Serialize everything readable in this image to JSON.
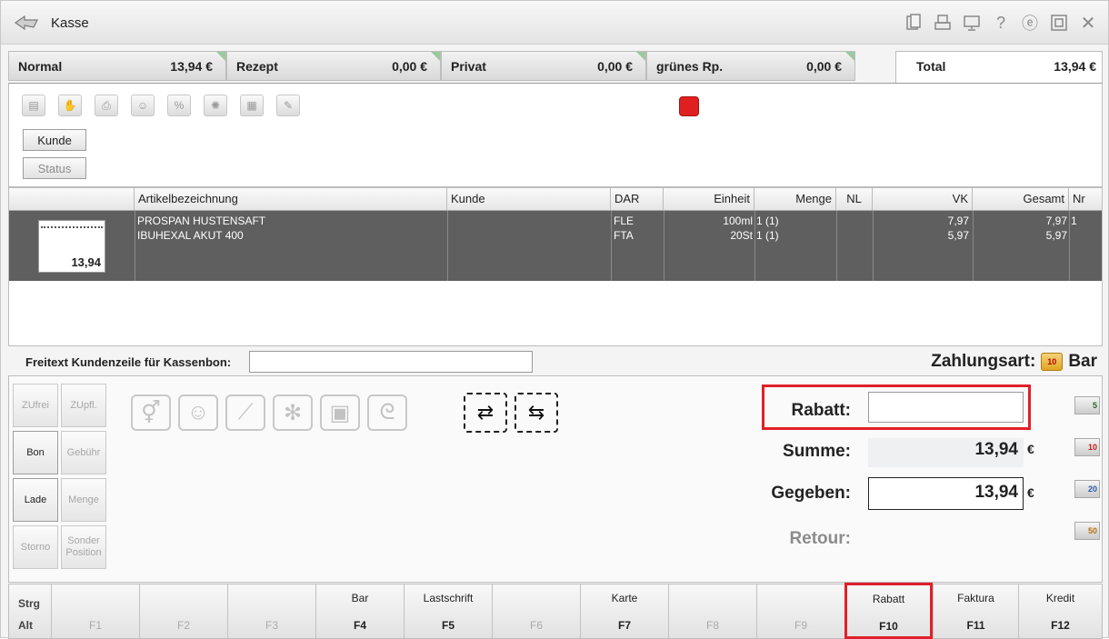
{
  "window": {
    "title": "Kasse"
  },
  "title_icons": [
    "clipboard-icon",
    "printer-icon",
    "monitor-icon",
    "help-icon",
    "e-icon",
    "restore-icon",
    "close-icon"
  ],
  "tabs": [
    {
      "label": "Normal",
      "value": "13,94 €"
    },
    {
      "label": "Rezept",
      "value": "0,00 €"
    },
    {
      "label": "Privat",
      "value": "0,00 €"
    },
    {
      "label": "grünes Rp.",
      "value": "0,00 €"
    }
  ],
  "total_tab": {
    "label": "Total",
    "value": "13,94 €"
  },
  "toolbar": {
    "kunde_label": "Kunde",
    "status_label": "Status"
  },
  "table": {
    "headers": [
      "Artikelbezeichnung",
      "Kunde",
      "DAR",
      "Einheit",
      "Menge",
      "NL",
      "VK",
      "Gesamt",
      "Nr"
    ],
    "receipt_total": "13,94",
    "rows": [
      {
        "name": "PROSPAN HUSTENSAFT",
        "kunde": "",
        "dar": "FLE",
        "einheit": "100ml",
        "menge": "1 (1)",
        "nl": "",
        "vk": "7,97",
        "gesamt": "7,97",
        "nr": "1"
      },
      {
        "name": "IBUHEXAL AKUT 400",
        "kunde": "",
        "dar": "FTA",
        "einheit": "20St",
        "menge": "1 (1)",
        "nl": "",
        "vk": "5,97",
        "gesamt": "5,97",
        "nr": ""
      }
    ]
  },
  "freitext": {
    "label": "Freitext Kundenzeile für Kassenbon:",
    "value": ""
  },
  "zahlungsart": {
    "label": "Zahlungsart:",
    "value": "Bar"
  },
  "left_buttons": {
    "zufrei": "ZUfrei",
    "zupfl": "ZUpfl.",
    "bon": "Bon",
    "gebuehr": "Gebühr",
    "lade": "Lade",
    "menge": "Menge",
    "storno": "Storno",
    "sonder_a": "Sonder",
    "sonder_b": "Position"
  },
  "payment": {
    "rabatt_label": "Rabatt:",
    "rabatt_value": "",
    "summe_label": "Summe:",
    "summe_value": "13,94",
    "gegeben_label": "Gegeben:",
    "gegeben_value": "13,94",
    "retour_label": "Retour:",
    "currency": "€"
  },
  "notes": [
    "5",
    "10",
    "20",
    "50"
  ],
  "modifier_keys": {
    "strg": "Strg",
    "alt": "Alt"
  },
  "fkeys": [
    {
      "label": "",
      "key": "F1",
      "enabled": false
    },
    {
      "label": "",
      "key": "F2",
      "enabled": false
    },
    {
      "label": "",
      "key": "F3",
      "enabled": false
    },
    {
      "label": "Bar",
      "key": "F4",
      "enabled": true
    },
    {
      "label": "Lastschrift",
      "key": "F5",
      "enabled": true
    },
    {
      "label": "",
      "key": "F6",
      "enabled": false
    },
    {
      "label": "Karte",
      "key": "F7",
      "enabled": true
    },
    {
      "label": "",
      "key": "F8",
      "enabled": false
    },
    {
      "label": "",
      "key": "F9",
      "enabled": false
    },
    {
      "label": "Rabatt",
      "key": "F10",
      "enabled": true
    },
    {
      "label": "Faktura",
      "key": "F11",
      "enabled": true
    },
    {
      "label": "Kredit",
      "key": "F12",
      "enabled": true
    }
  ]
}
